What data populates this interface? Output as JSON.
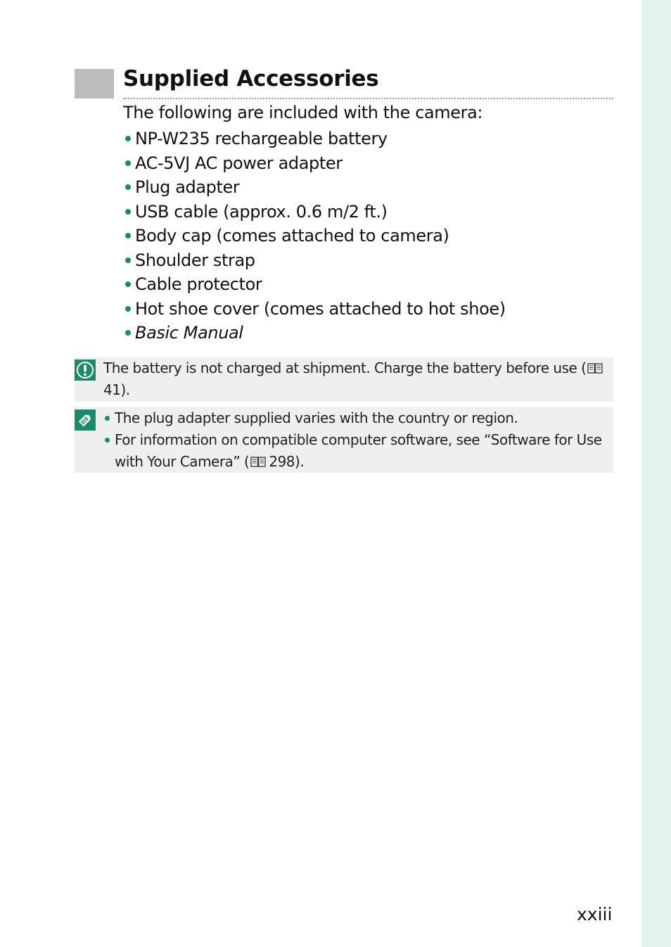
{
  "section": {
    "title": "Supplied Accessories",
    "intro": "The following are included with the camera:",
    "items": [
      {
        "label": "NP-W235 rechargeable battery",
        "italic": false
      },
      {
        "label": "AC-5VJ AC power adapter",
        "italic": false
      },
      {
        "label": "Plug adapter",
        "italic": false
      },
      {
        "label": "USB cable (approx. 0.6 m/2 ft.)",
        "italic": false
      },
      {
        "label": "Body cap (comes attached to camera)",
        "italic": false
      },
      {
        "label": "Shoulder strap",
        "italic": false
      },
      {
        "label": "Cable protector",
        "italic": false
      },
      {
        "label": "Hot shoe cover (comes attached to hot shoe)",
        "italic": false
      },
      {
        "label": "Basic Manual",
        "italic": true
      }
    ]
  },
  "caution_note": {
    "icon": "caution-exclamation-icon",
    "text_before": "The battery is not charged at shipment. Charge the battery before use (",
    "page_ref": "41",
    "text_after": ")."
  },
  "tip_note": {
    "icon": "pencil-note-icon",
    "items": [
      {
        "text": "The plug adapter supplied varies with the country or region."
      },
      {
        "text": "For information on compatible computer software, see “Software for Use with Your Camera” (",
        "page_ref": "298",
        "text_after": ")."
      }
    ]
  },
  "colors": {
    "accent": "#1a8a6a",
    "side_tab": "#e3f2ee",
    "note_bg": "#efefef",
    "heading_block": "#bcbcbc"
  },
  "footer": {
    "page_number": "xxiii"
  }
}
